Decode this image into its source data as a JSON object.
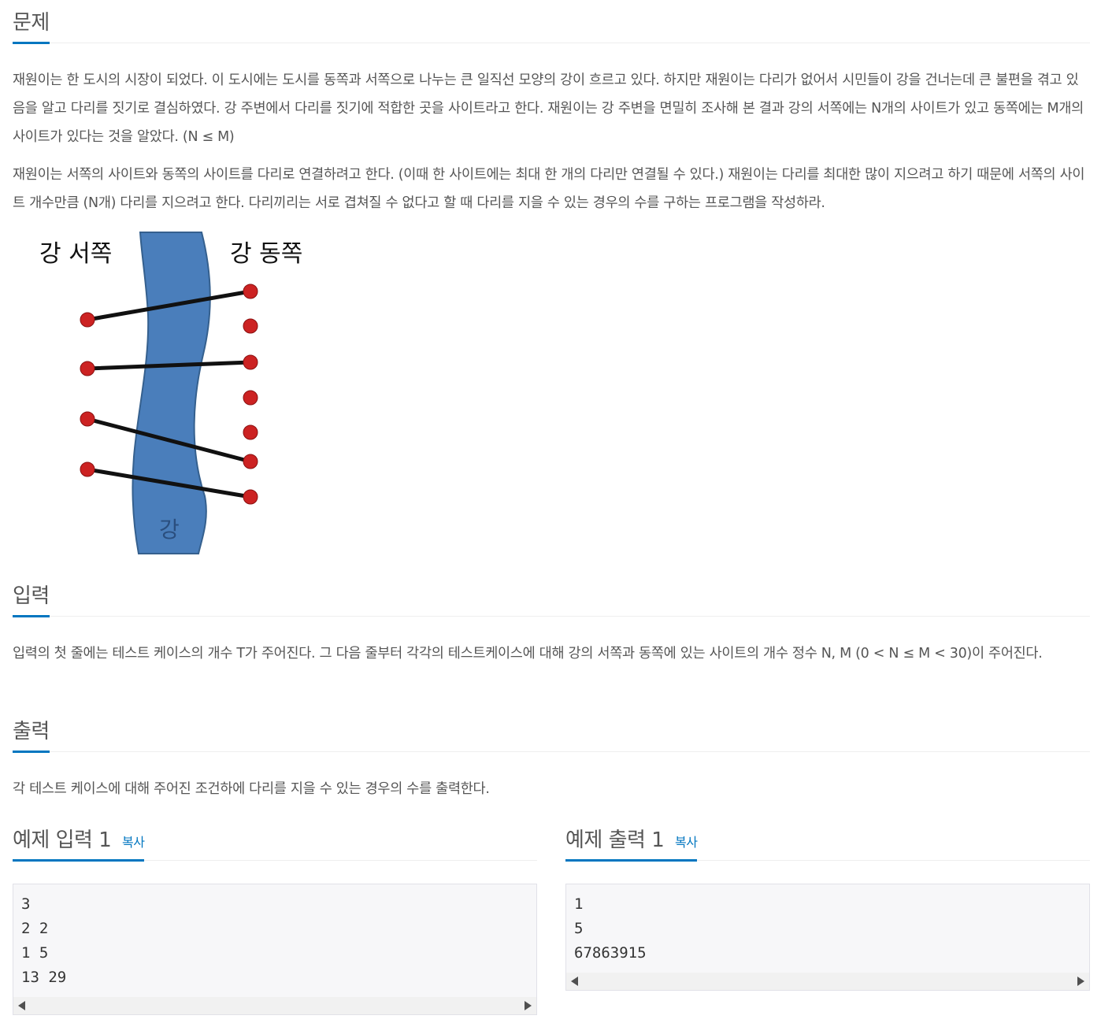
{
  "problem": {
    "title": "문제",
    "paragraphs": [
      "재원이는 한 도시의 시장이 되었다. 이 도시에는 도시를 동쪽과 서쪽으로 나누는 큰 일직선 모양의 강이 흐르고 있다. 하지만 재원이는 다리가 없어서 시민들이 강을 건너는데 큰 불편을 겪고 있음을 알고 다리를 짓기로 결심하였다. 강 주변에서 다리를 짓기에 적합한 곳을 사이트라고 한다. 재원이는 강 주변을 면밀히 조사해 본 결과 강의 서쪽에는 N개의 사이트가 있고 동쪽에는 M개의 사이트가 있다는 것을 알았다. (N ≤ M)",
      "재원이는 서쪽의 사이트와 동쪽의 사이트를 다리로 연결하려고 한다. (이때 한 사이트에는 최대 한 개의 다리만 연결될 수 있다.) 재원이는 다리를 최대한 많이 지으려고 하기 때문에 서쪽의 사이트 개수만큼 (N개) 다리를 지으려고 한다. 다리끼리는 서로 겹쳐질 수 없다고 할 때 다리를 지을 수 있는 경우의 수를 구하는 프로그램을 작성하라."
    ],
    "figure": {
      "west_label": "강 서쪽",
      "east_label": "강 동쪽",
      "river_label": "강",
      "river_color": "#4a7ebb",
      "site_color": "#cc2222"
    }
  },
  "input": {
    "title": "입력",
    "text": "입력의 첫 줄에는 테스트 케이스의 개수 T가 주어진다. 그 다음 줄부터 각각의 테스트케이스에 대해 강의 서쪽과 동쪽에 있는 사이트의 개수 정수 N, M (0 < N ≤ M < 30)이 주어진다."
  },
  "output": {
    "title": "출력",
    "text": "각 테스트 케이스에 대해 주어진 조건하에 다리를 지을 수 있는 경우의 수를 출력한다."
  },
  "sample_input": {
    "title": "예제 입력 1",
    "copy_label": "복사",
    "content": "3\n2 2\n1 5\n13 29"
  },
  "sample_output": {
    "title": "예제 출력 1",
    "copy_label": "복사",
    "content": "1\n5\n67863915"
  },
  "accent_color": "#0076c0"
}
